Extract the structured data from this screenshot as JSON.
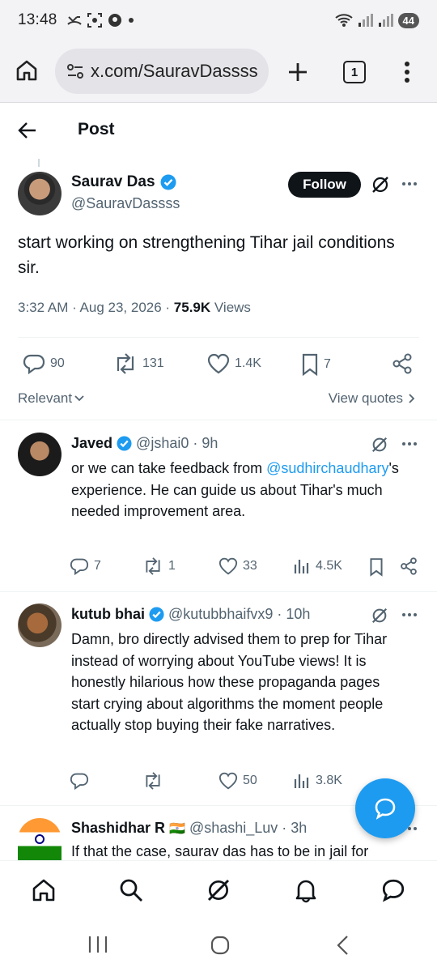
{
  "status_bar": {
    "time": "13:48",
    "battery": "44"
  },
  "browser": {
    "url": "x.com/SauravDassss",
    "tab_count": "1"
  },
  "header": {
    "title": "Post"
  },
  "main_post": {
    "name": "Saurav Das",
    "handle": "@SauravDassss",
    "follow_label": "Follow",
    "text": "start working on strengthening Tihar jail conditions sir.",
    "time": "3:32 AM · Aug 23, 2026 · ",
    "views_count": "75.9K",
    "views_label": " Views",
    "replies": "90",
    "reposts": "131",
    "likes": "1.4K",
    "bookmarks": "7"
  },
  "sort": {
    "relevant_label": "Relevant",
    "view_quotes_label": "View quotes"
  },
  "replies": [
    {
      "name": "Javed",
      "handle": "@jshai0 · 9h",
      "text_pre": "or we can take feedback from ",
      "mention": "@sudhirchaudhary",
      "text_post": "'s experience. He can guide us about Tihar's much needed improvement area.",
      "replies": "7",
      "reposts": "1",
      "likes": "33",
      "views": "4.5K"
    },
    {
      "name": "kutub bhai",
      "handle": "@kutubbhaifvx9 · 10h",
      "text": "Damn, bro directly advised them to prep for Tihar instead of worrying about YouTube views! It is honestly hilarious how these propaganda pages start crying about algorithms the moment people actually stop buying their fake narratives.",
      "likes": "50",
      "views": "3.8K"
    },
    {
      "name": "Shashidhar R",
      "flag": "🇮🇳",
      "handle": "@shashi_Luv · 3h",
      "text": "If that the case, saurav das has to be in jail for"
    }
  ],
  "colors": {
    "accent": "#1d9bf0",
    "text": "#0f1419",
    "secondary": "#536471"
  }
}
